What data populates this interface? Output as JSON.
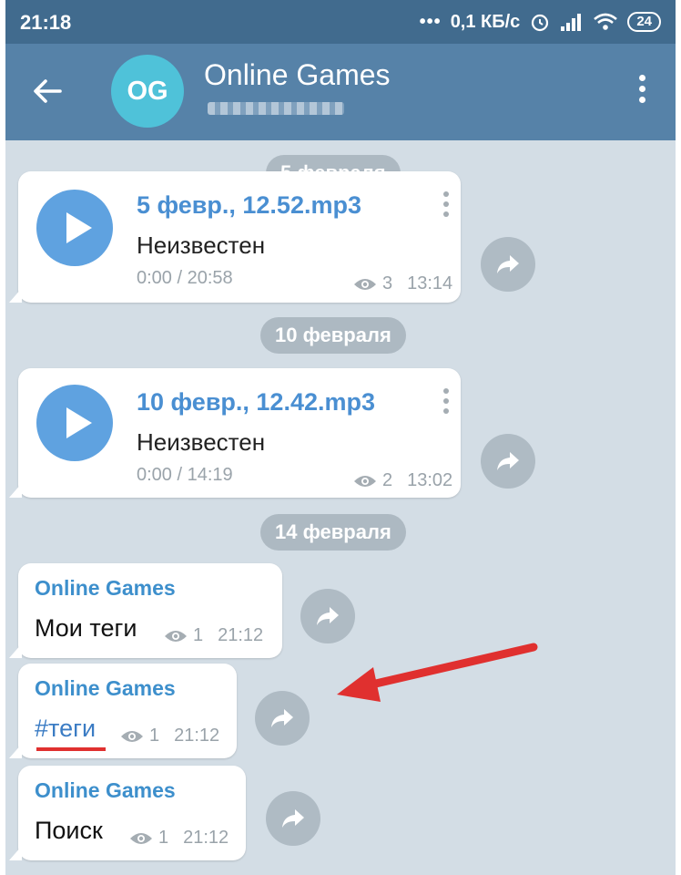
{
  "status_bar": {
    "time": "21:18",
    "network_speed": "0,1 КБ/с",
    "battery": "24",
    "icons": [
      "alarm-icon",
      "signal-icon",
      "wifi-icon",
      "battery-icon"
    ]
  },
  "header": {
    "avatar_initials": "OG",
    "title": "Online Games",
    "icons": [
      "back-arrow-icon",
      "more-vertical-icon"
    ]
  },
  "dates": {
    "d1": "5 февраля",
    "d2": "10 февраля",
    "d3": "14 февраля"
  },
  "audio_messages": [
    {
      "file_name": "5 февр., 12.52.mp3",
      "performer": "Неизвестен",
      "duration": "0:00 / 20:58",
      "views": "3",
      "time": "13:14"
    },
    {
      "file_name": "10 февр., 12.42.mp3",
      "performer": "Неизвестен",
      "duration": "0:00 / 14:19",
      "views": "2",
      "time": "13:02"
    }
  ],
  "text_messages": [
    {
      "sender": "Online Games",
      "text": "Мои теги",
      "views": "1",
      "time": "21:12"
    },
    {
      "sender": "Online Games",
      "text": "#теги",
      "views": "1",
      "time": "21:12"
    },
    {
      "sender": "Online Games",
      "text": "Поиск",
      "views": "1",
      "time": "21:12"
    }
  ],
  "colors": {
    "status_bar": "#416b8e",
    "header": "#5682a8",
    "chat_bg": "#d3dde5",
    "accent_blue": "#4a8fd2",
    "annotation_red": "#e0302f"
  }
}
